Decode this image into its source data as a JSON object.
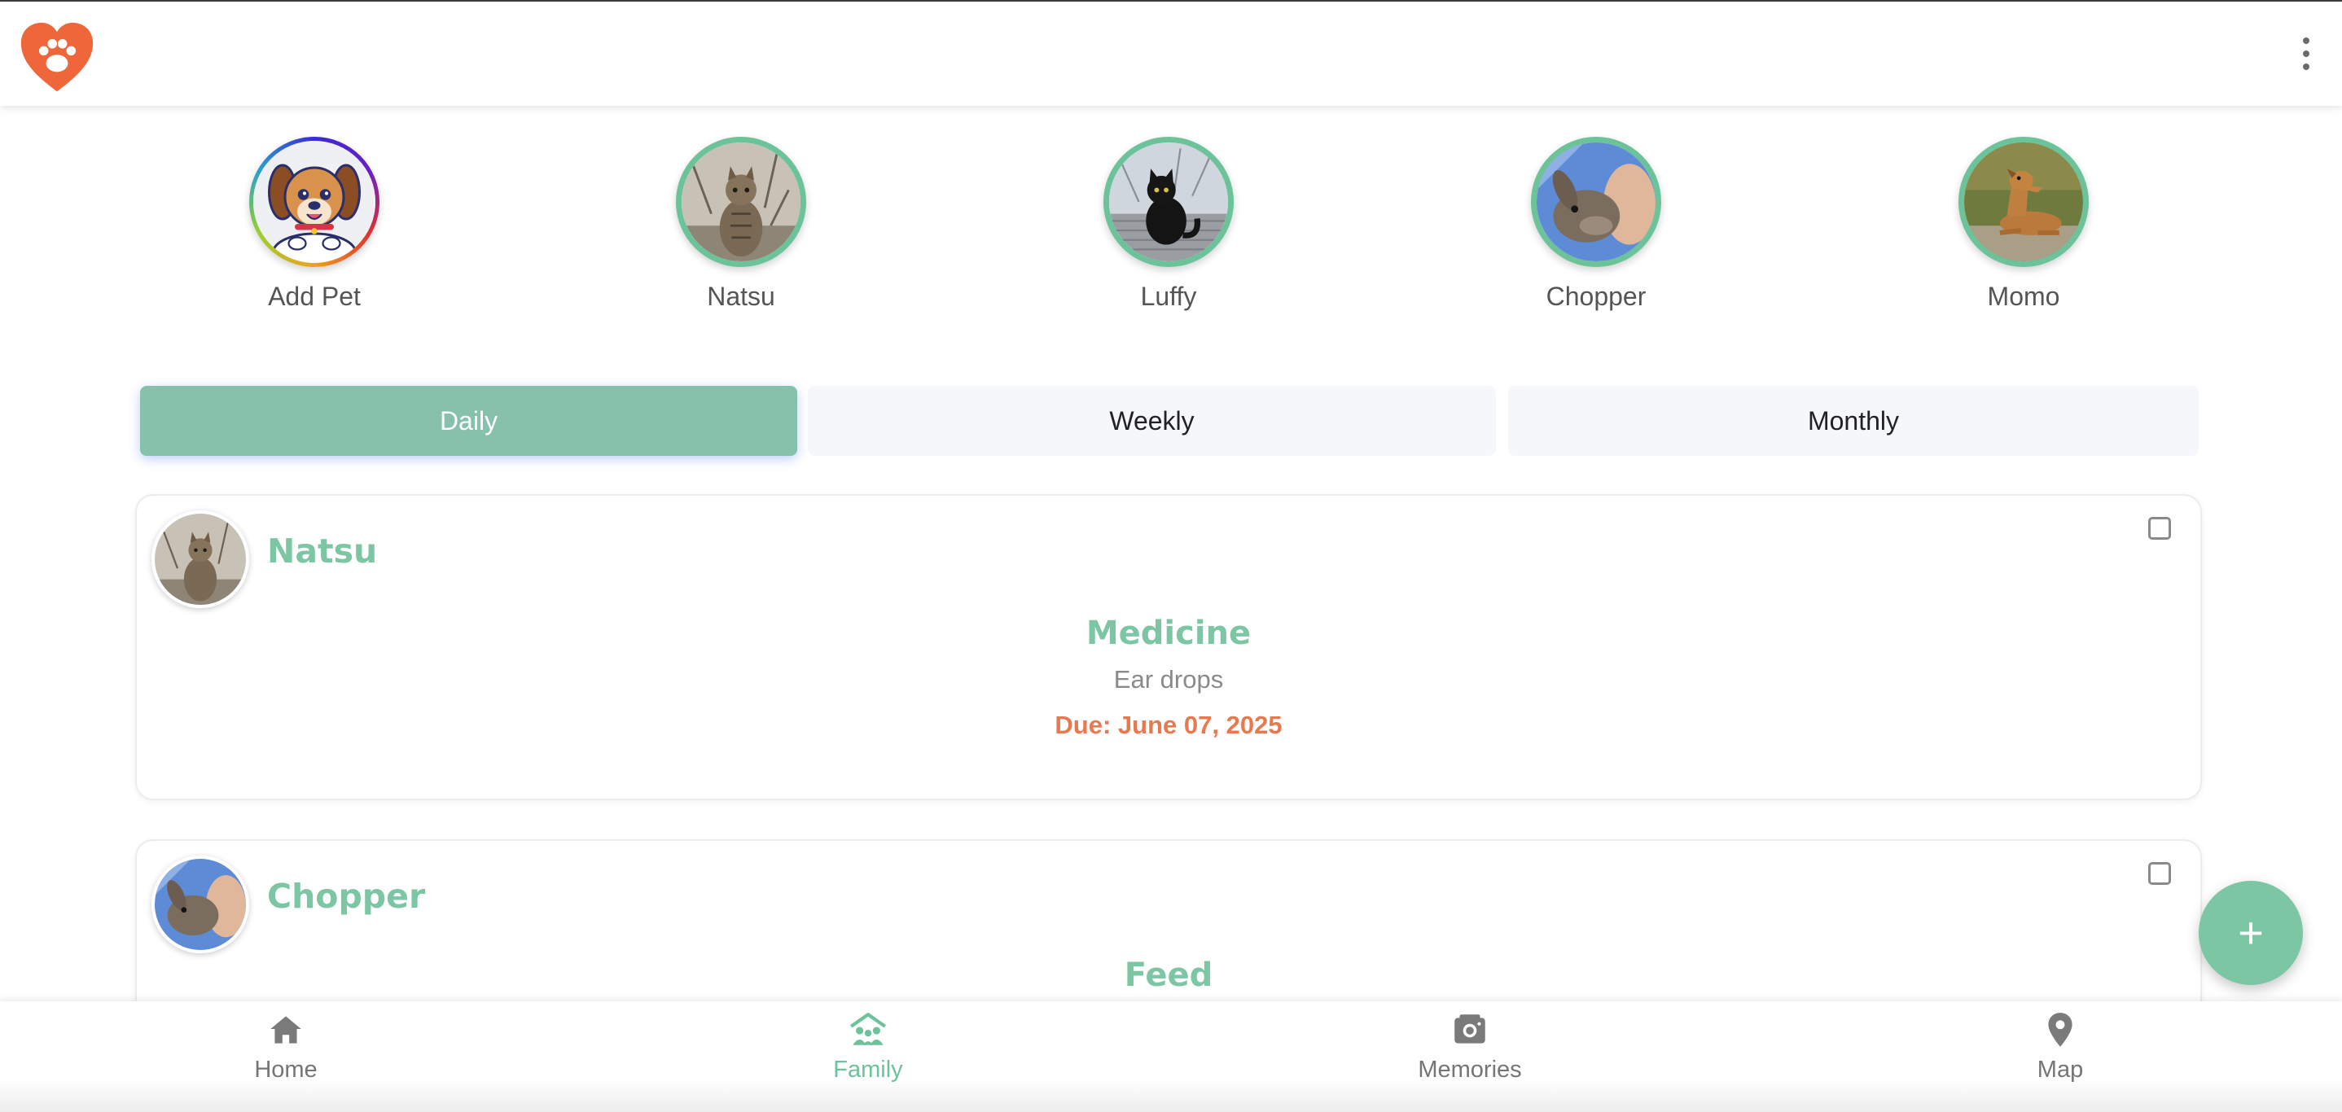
{
  "app": {
    "logo_icon": "paw-heart-logo-icon",
    "menu_icon": "more-vertical-icon",
    "colors": {
      "accent": "#7cc6a4",
      "tab_active": "#87c0ab",
      "due": "#e8784e",
      "logo": "#f0663b"
    }
  },
  "pets": [
    {
      "name": "Add Pet",
      "icon": "cartoon-dog-add-icon"
    },
    {
      "name": "Natsu",
      "icon": "tabby-cat-photo"
    },
    {
      "name": "Luffy",
      "icon": "black-cat-photo"
    },
    {
      "name": "Chopper",
      "icon": "rabbit-photo"
    },
    {
      "name": "Momo",
      "icon": "dog-photo"
    }
  ],
  "tabs": [
    {
      "label": "Daily",
      "active": true
    },
    {
      "label": "Weekly",
      "active": false
    },
    {
      "label": "Monthly",
      "active": false
    }
  ],
  "tasks": [
    {
      "pet": "Natsu",
      "type": "Medicine",
      "detail": "Ear drops",
      "due": "Due: June 07, 2025",
      "checked": false
    },
    {
      "pet": "Chopper",
      "type": "Feed",
      "checked": false
    }
  ],
  "fab": {
    "label": "+",
    "icon": "plus-icon"
  },
  "bottom_nav": [
    {
      "label": "Home",
      "icon": "home-icon",
      "active": false
    },
    {
      "label": "Family",
      "icon": "family-icon",
      "active": true
    },
    {
      "label": "Memories",
      "icon": "camera-album-icon",
      "active": false
    },
    {
      "label": "Map",
      "icon": "map-pin-icon",
      "active": false
    }
  ]
}
